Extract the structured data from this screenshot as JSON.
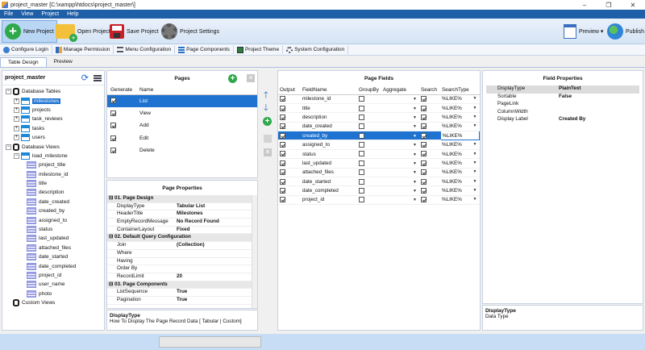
{
  "window": {
    "title": "project_master [C:\\xampp\\htdocs\\project_master\\]",
    "min": "–",
    "max": "❐",
    "close": "✕"
  },
  "menu": [
    "File",
    "View",
    "Project",
    "Help"
  ],
  "toolbar": {
    "new_project": "New Project",
    "open_project": "Open Project",
    "save_project": "Save Project",
    "project_settings": "Project Settings",
    "preview": "Preview ▾",
    "publish": "Publish"
  },
  "subbar": [
    "Configure Login",
    "Manage Permission",
    "Menu Configuration",
    "Page Components",
    "Project Theme",
    "System Configuration"
  ],
  "tabs": [
    "Table Design",
    "Preview"
  ],
  "tree": {
    "project": "project_master",
    "tables_label": "Database Tables",
    "tables": [
      "milestones",
      "projects",
      "task_reviews",
      "tasks",
      "users"
    ],
    "views_label": "Database Views",
    "view_name": "load_milestone",
    "view_fields": [
      "project_title",
      "milestone_id",
      "title",
      "description",
      "date_created",
      "created_by",
      "assigned_to",
      "status",
      "last_updated",
      "attached_files",
      "date_started",
      "date_completed",
      "project_id",
      "user_name",
      "photo"
    ],
    "custom_views": "Custom Views"
  },
  "pages": {
    "title": "Pages",
    "col_generate": "Generate",
    "col_name": "Name",
    "rows": [
      "List",
      "View",
      "Add",
      "Edit",
      "Delete"
    ]
  },
  "page_properties": {
    "title": "Page Properties",
    "rows": [
      {
        "cat": true,
        "k": "⊟  01. Page Design"
      },
      {
        "k": "DisplayType",
        "v": "Tabular List"
      },
      {
        "k": "HeaderTitle",
        "v": "Milestones"
      },
      {
        "k": "EmptyRecordMessage",
        "v": "No Record Found"
      },
      {
        "k": "ContainerLayout",
        "v": "Fixed"
      },
      {
        "cat": true,
        "k": "⊟  02. Default Query Configuration"
      },
      {
        "k": "Join",
        "v": "(Collection)"
      },
      {
        "k": "Where",
        "v": ""
      },
      {
        "k": "Having",
        "v": ""
      },
      {
        "k": "Order By",
        "v": ""
      },
      {
        "k": "RecordLimit",
        "v": "20"
      },
      {
        "cat": true,
        "k": "⊟  03. Page Components"
      },
      {
        "k": "ListSequence",
        "v": "True"
      },
      {
        "k": "Pagination",
        "v": "True"
      }
    ],
    "desc_title": "DisplayType",
    "desc_text": "How To Display The Page Record Data [ Tabular | Custom]"
  },
  "page_fields": {
    "title": "Page Fields",
    "cols": [
      "Output",
      "FieldName",
      "GroupBy",
      "Aggregate",
      "Search",
      "SearchType"
    ],
    "search_type": "%LIKE%",
    "rows": [
      "milestone_id",
      "title",
      "description",
      "date_created",
      "created_by",
      "assigned_to",
      "status",
      "last_updated",
      "attached_files",
      "date_started",
      "date_completed",
      "project_id"
    ]
  },
  "field_properties": {
    "title": "Field Properties",
    "rows": [
      {
        "k": "DisplayType",
        "v": "PlainText"
      },
      {
        "k": "Sortable",
        "v": "False"
      },
      {
        "k": "PageLink",
        "v": ""
      },
      {
        "k": "ColumnWidth",
        "v": ""
      },
      {
        "k": "Display Label",
        "v": "Created By"
      }
    ],
    "desc_title": "DisplayType",
    "desc_text": "Data Type"
  }
}
